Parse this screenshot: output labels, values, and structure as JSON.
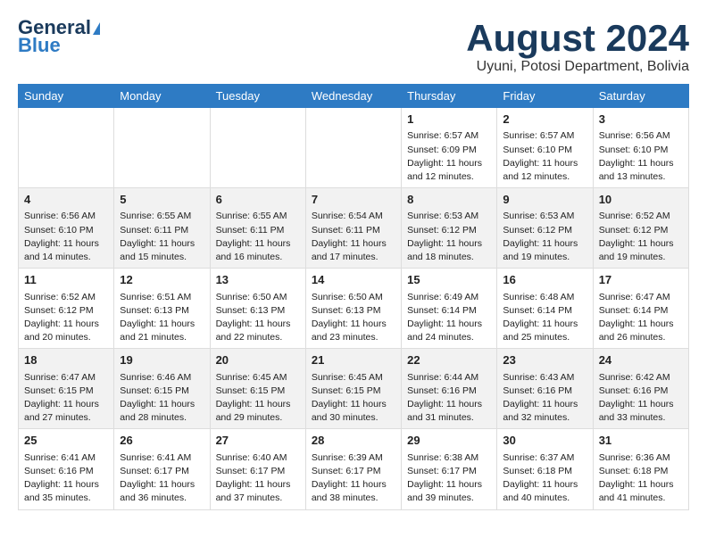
{
  "logo": {
    "general": "General",
    "blue": "Blue"
  },
  "title": "August 2024",
  "subtitle": "Uyuni, Potosi Department, Bolivia",
  "weekdays": [
    "Sunday",
    "Monday",
    "Tuesday",
    "Wednesday",
    "Thursday",
    "Friday",
    "Saturday"
  ],
  "weeks": [
    [
      {
        "day": "",
        "info": ""
      },
      {
        "day": "",
        "info": ""
      },
      {
        "day": "",
        "info": ""
      },
      {
        "day": "",
        "info": ""
      },
      {
        "day": "1",
        "info": "Sunrise: 6:57 AM\nSunset: 6:09 PM\nDaylight: 11 hours\nand 12 minutes."
      },
      {
        "day": "2",
        "info": "Sunrise: 6:57 AM\nSunset: 6:10 PM\nDaylight: 11 hours\nand 12 minutes."
      },
      {
        "day": "3",
        "info": "Sunrise: 6:56 AM\nSunset: 6:10 PM\nDaylight: 11 hours\nand 13 minutes."
      }
    ],
    [
      {
        "day": "4",
        "info": "Sunrise: 6:56 AM\nSunset: 6:10 PM\nDaylight: 11 hours\nand 14 minutes."
      },
      {
        "day": "5",
        "info": "Sunrise: 6:55 AM\nSunset: 6:11 PM\nDaylight: 11 hours\nand 15 minutes."
      },
      {
        "day": "6",
        "info": "Sunrise: 6:55 AM\nSunset: 6:11 PM\nDaylight: 11 hours\nand 16 minutes."
      },
      {
        "day": "7",
        "info": "Sunrise: 6:54 AM\nSunset: 6:11 PM\nDaylight: 11 hours\nand 17 minutes."
      },
      {
        "day": "8",
        "info": "Sunrise: 6:53 AM\nSunset: 6:12 PM\nDaylight: 11 hours\nand 18 minutes."
      },
      {
        "day": "9",
        "info": "Sunrise: 6:53 AM\nSunset: 6:12 PM\nDaylight: 11 hours\nand 19 minutes."
      },
      {
        "day": "10",
        "info": "Sunrise: 6:52 AM\nSunset: 6:12 PM\nDaylight: 11 hours\nand 19 minutes."
      }
    ],
    [
      {
        "day": "11",
        "info": "Sunrise: 6:52 AM\nSunset: 6:12 PM\nDaylight: 11 hours\nand 20 minutes."
      },
      {
        "day": "12",
        "info": "Sunrise: 6:51 AM\nSunset: 6:13 PM\nDaylight: 11 hours\nand 21 minutes."
      },
      {
        "day": "13",
        "info": "Sunrise: 6:50 AM\nSunset: 6:13 PM\nDaylight: 11 hours\nand 22 minutes."
      },
      {
        "day": "14",
        "info": "Sunrise: 6:50 AM\nSunset: 6:13 PM\nDaylight: 11 hours\nand 23 minutes."
      },
      {
        "day": "15",
        "info": "Sunrise: 6:49 AM\nSunset: 6:14 PM\nDaylight: 11 hours\nand 24 minutes."
      },
      {
        "day": "16",
        "info": "Sunrise: 6:48 AM\nSunset: 6:14 PM\nDaylight: 11 hours\nand 25 minutes."
      },
      {
        "day": "17",
        "info": "Sunrise: 6:47 AM\nSunset: 6:14 PM\nDaylight: 11 hours\nand 26 minutes."
      }
    ],
    [
      {
        "day": "18",
        "info": "Sunrise: 6:47 AM\nSunset: 6:15 PM\nDaylight: 11 hours\nand 27 minutes."
      },
      {
        "day": "19",
        "info": "Sunrise: 6:46 AM\nSunset: 6:15 PM\nDaylight: 11 hours\nand 28 minutes."
      },
      {
        "day": "20",
        "info": "Sunrise: 6:45 AM\nSunset: 6:15 PM\nDaylight: 11 hours\nand 29 minutes."
      },
      {
        "day": "21",
        "info": "Sunrise: 6:45 AM\nSunset: 6:15 PM\nDaylight: 11 hours\nand 30 minutes."
      },
      {
        "day": "22",
        "info": "Sunrise: 6:44 AM\nSunset: 6:16 PM\nDaylight: 11 hours\nand 31 minutes."
      },
      {
        "day": "23",
        "info": "Sunrise: 6:43 AM\nSunset: 6:16 PM\nDaylight: 11 hours\nand 32 minutes."
      },
      {
        "day": "24",
        "info": "Sunrise: 6:42 AM\nSunset: 6:16 PM\nDaylight: 11 hours\nand 33 minutes."
      }
    ],
    [
      {
        "day": "25",
        "info": "Sunrise: 6:41 AM\nSunset: 6:16 PM\nDaylight: 11 hours\nand 35 minutes."
      },
      {
        "day": "26",
        "info": "Sunrise: 6:41 AM\nSunset: 6:17 PM\nDaylight: 11 hours\nand 36 minutes."
      },
      {
        "day": "27",
        "info": "Sunrise: 6:40 AM\nSunset: 6:17 PM\nDaylight: 11 hours\nand 37 minutes."
      },
      {
        "day": "28",
        "info": "Sunrise: 6:39 AM\nSunset: 6:17 PM\nDaylight: 11 hours\nand 38 minutes."
      },
      {
        "day": "29",
        "info": "Sunrise: 6:38 AM\nSunset: 6:17 PM\nDaylight: 11 hours\nand 39 minutes."
      },
      {
        "day": "30",
        "info": "Sunrise: 6:37 AM\nSunset: 6:18 PM\nDaylight: 11 hours\nand 40 minutes."
      },
      {
        "day": "31",
        "info": "Sunrise: 6:36 AM\nSunset: 6:18 PM\nDaylight: 11 hours\nand 41 minutes."
      }
    ]
  ]
}
